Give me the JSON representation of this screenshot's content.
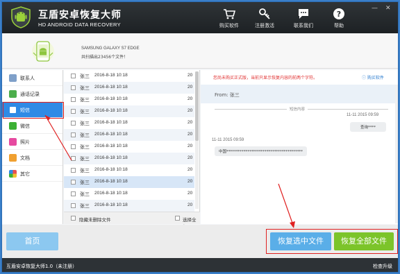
{
  "app": {
    "title_cn": "互盾安卓恢复大师",
    "title_en": "HD ANDROID DATA RECOVERY"
  },
  "toolbar": {
    "buy": "购买软件",
    "register": "注册激活",
    "contact": "联系我们",
    "help": "帮助"
  },
  "device": {
    "model": "SAMSUNG GALAXY S7 EDGE",
    "scan_info": "共扫描出23456个文件！"
  },
  "sidebar": {
    "items": [
      {
        "label": "联系人",
        "icon": "contacts-icon",
        "color": "#7fa0c9"
      },
      {
        "label": "通话记录",
        "icon": "phone-icon",
        "color": "#4cae4c"
      },
      {
        "label": "短信",
        "icon": "message-icon",
        "color": "#ffffff"
      },
      {
        "label": "微信",
        "icon": "wechat-icon",
        "color": "#3cb034"
      },
      {
        "label": "照片",
        "icon": "photo-icon",
        "color": "#e64aa0"
      },
      {
        "label": "文档",
        "icon": "document-icon",
        "color": "#f0a030"
      },
      {
        "label": "其它",
        "icon": "apps-icon",
        "color": "#e85050"
      }
    ]
  },
  "messages": {
    "rows": [
      {
        "name": "张三",
        "date": "2016-8-18 10:18",
        "count": "20"
      },
      {
        "name": "张三",
        "date": "2016-8-18 10:18",
        "count": "20"
      },
      {
        "name": "张三",
        "date": "2016-8-18 10:18",
        "count": "20"
      },
      {
        "name": "张三",
        "date": "2016-8-18 10:18",
        "count": "20"
      },
      {
        "name": "张三",
        "date": "2016-8-18 10:18",
        "count": "20"
      },
      {
        "name": "张三",
        "date": "2016-8-18 10:18",
        "count": "20"
      },
      {
        "name": "张三",
        "date": "2016-8-18 10:18",
        "count": "20"
      },
      {
        "name": "张三",
        "date": "2016-8-18 10:18",
        "count": "20"
      },
      {
        "name": "张三",
        "date": "2016-8-18 10:18",
        "count": "20"
      },
      {
        "name": "张三",
        "date": "2016-8-18 10:18",
        "count": "20"
      },
      {
        "name": "张三",
        "date": "2016-8-18 10:18",
        "count": "20"
      },
      {
        "name": "张三",
        "date": "2016-8-18 10:18",
        "count": "20"
      }
    ],
    "hide_unchecked": "隐藏未删除文件",
    "select_all": "选择全部"
  },
  "detail": {
    "notice": "您尚未购买正式版，当前只显示恢复内容的前两个字符。",
    "buy_link": "购买软件",
    "from": "From: 张三",
    "divider": "短信内容",
    "msg1_time": "11-11  2015  09:59",
    "msg1_text": "查询****",
    "msg2_time": "11-11  2015  09:59",
    "msg2_text": "中国****************************************"
  },
  "buttons": {
    "home": "首页",
    "recover_selected": "恢复选中文件",
    "recover_all": "恢复全部文件"
  },
  "status": {
    "version": "互盾安卓恢复大师1.0（未注册）",
    "upgrade": "检查升级"
  },
  "colors": {
    "accent": "#2f8ae5",
    "blue_button": "#5aaee8",
    "green_button": "#7cc42a",
    "highlight": "#e02020"
  }
}
